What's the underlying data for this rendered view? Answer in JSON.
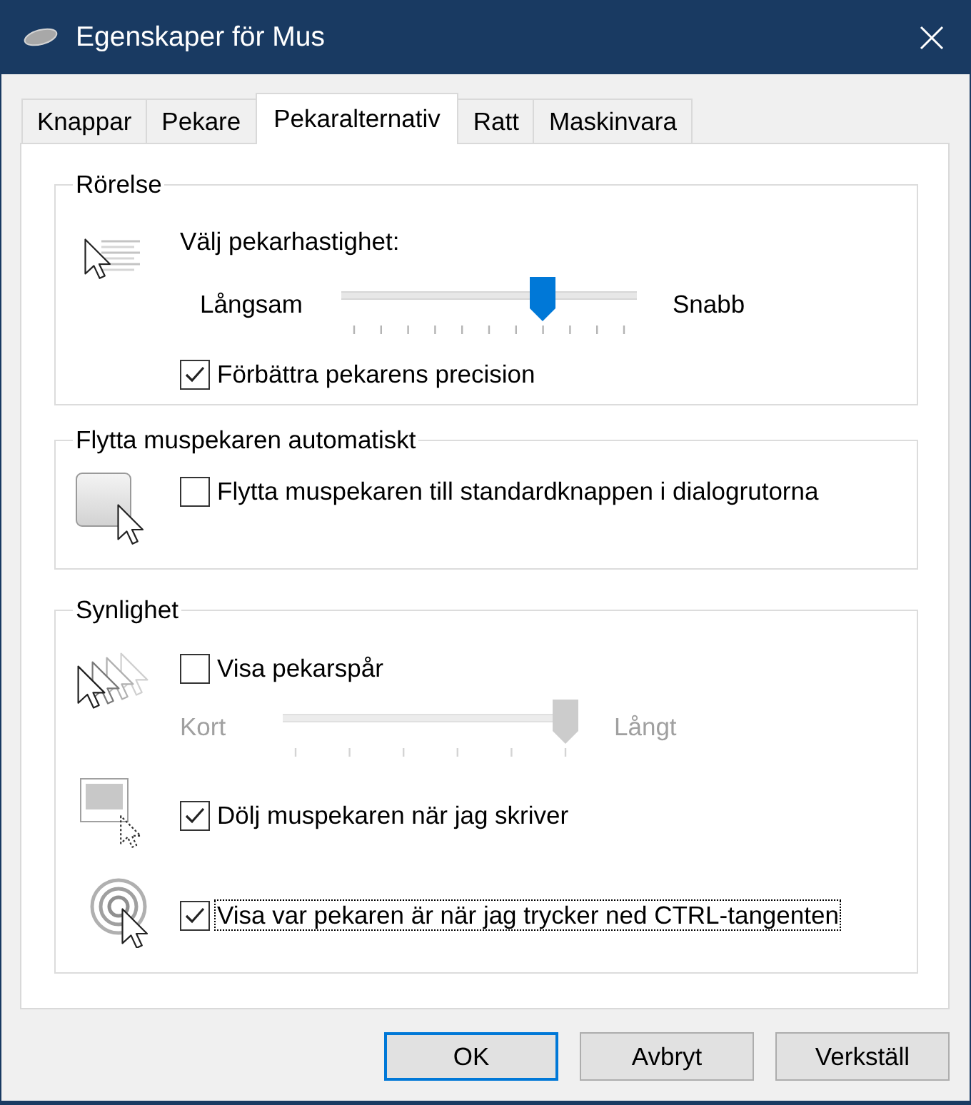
{
  "window": {
    "title": "Egenskaper för Mus"
  },
  "tabs": [
    {
      "label": "Knappar",
      "selected": false
    },
    {
      "label": "Pekare",
      "selected": false
    },
    {
      "label": "Pekaralternativ",
      "selected": true
    },
    {
      "label": "Ratt",
      "selected": false
    },
    {
      "label": "Maskinvara",
      "selected": false
    }
  ],
  "groups": [
    {
      "title": "Rörelse",
      "sections": [
        {
          "rows": [
            {
              "kind": "slider",
              "label": "Välj pekarhastighet:",
              "min_label": "Långsam",
              "max_label": "Snabb",
              "level": 0.7,
              "disabled": false
            },
            {
              "kind": "checkbox",
              "label": "Förbättra pekarens precision",
              "checked": true,
              "focused": false
            }
          ]
        }
      ]
    },
    {
      "title": "Flytta muspekaren automatiskt",
      "sections": [
        {
          "rows": [
            {
              "kind": "checkbox",
              "label": "Flytta muspekaren till standardknappen i dialogrutorna",
              "checked": false,
              "focused": false
            }
          ]
        }
      ]
    },
    {
      "title": "Synlighet",
      "sections": [
        {
          "rows": [
            {
              "kind": "checkbox",
              "label": "Visa pekarspår",
              "checked": false,
              "focused": false
            },
            {
              "kind": "slider",
              "min_label": "Kort",
              "max_label": "Långt",
              "level": 1,
              "disabled": true
            }
          ]
        },
        {
          "rows": [
            {
              "kind": "checkbox",
              "label": "Dölj muspekaren när jag skriver",
              "checked": true,
              "focused": false
            }
          ]
        },
        {
          "rows": [
            {
              "kind": "checkbox",
              "label": "Visa var pekaren är när jag trycker ned CTRL-tangenten",
              "checked": true,
              "focused": true
            }
          ]
        }
      ]
    }
  ],
  "buttons": [
    {
      "label": "OK",
      "default": true
    },
    {
      "label": "Avbryt",
      "default": false
    },
    {
      "label": "Verkställ",
      "default": false
    }
  ]
}
